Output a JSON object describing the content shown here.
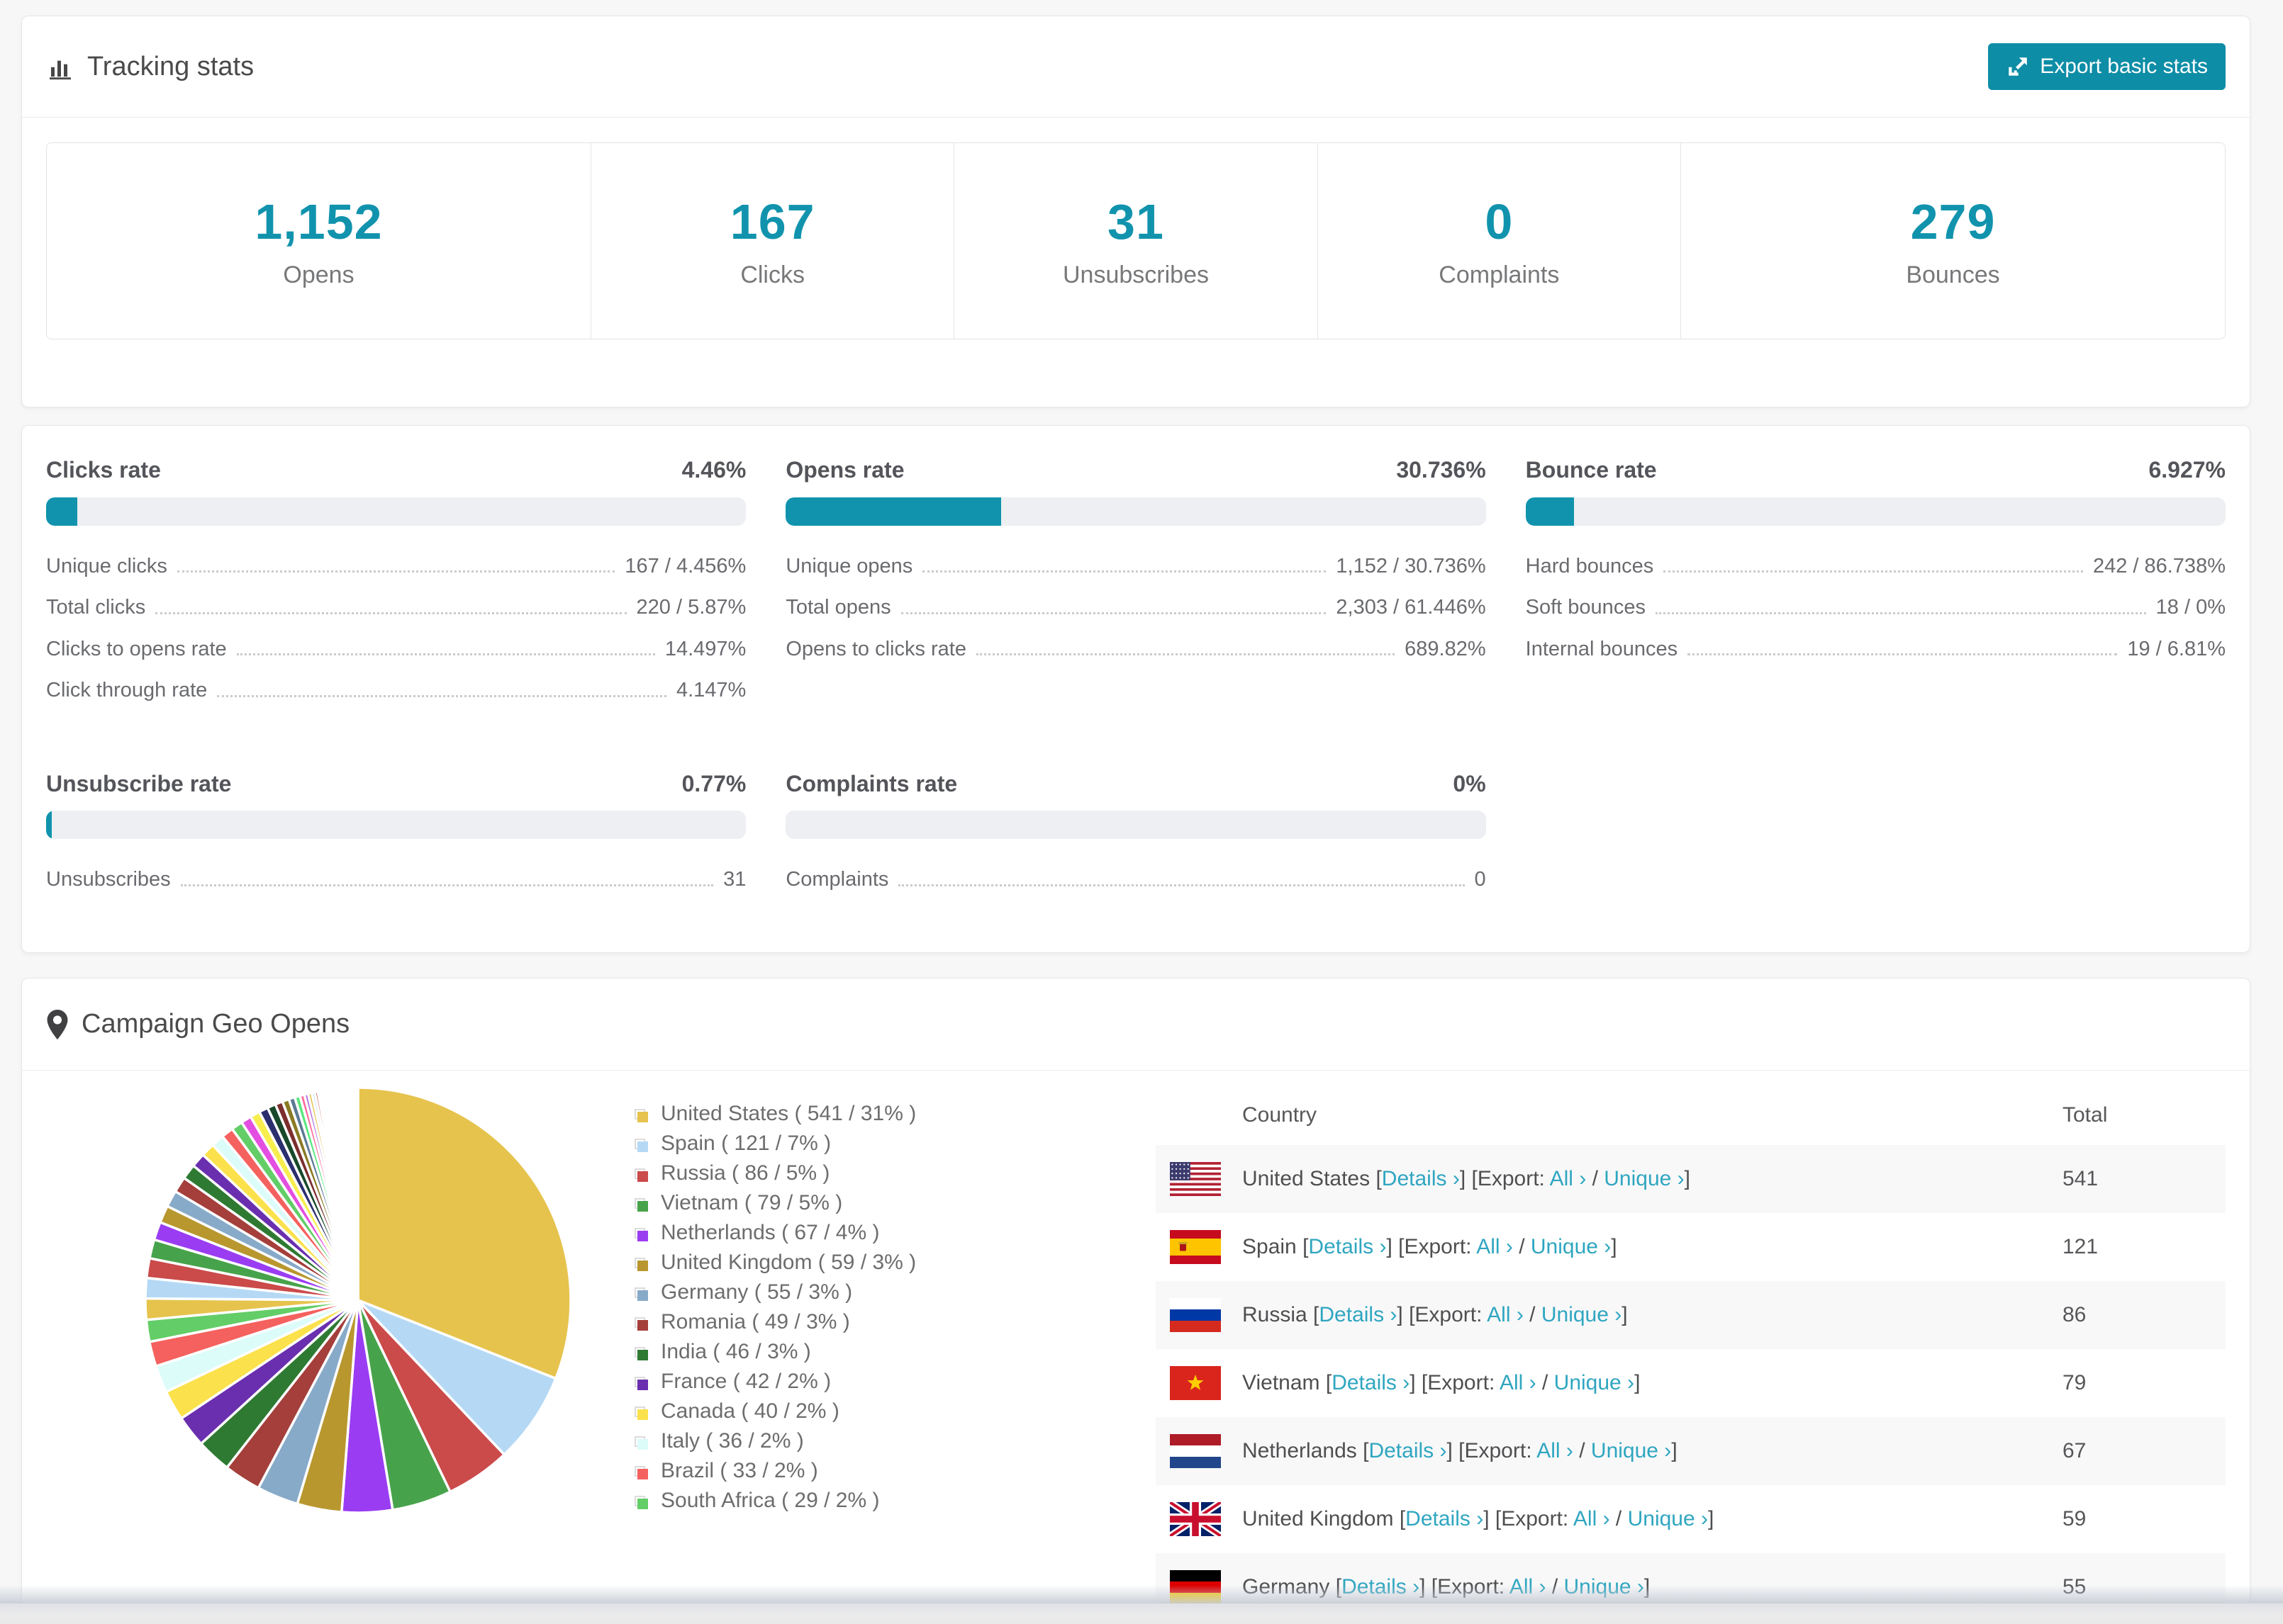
{
  "colors": {
    "accent": "#1193ad",
    "link": "#2fa6c0",
    "button": "#0d8da6",
    "track": "#edeff2"
  },
  "tracking": {
    "title": "Tracking stats",
    "export_label": "Export basic stats",
    "stats": [
      {
        "value": "1,152",
        "label": "Opens"
      },
      {
        "value": "167",
        "label": "Clicks"
      },
      {
        "value": "31",
        "label": "Unsubscribes"
      },
      {
        "value": "0",
        "label": "Complaints"
      },
      {
        "value": "279",
        "label": "Bounces"
      }
    ]
  },
  "rates": {
    "sections": [
      {
        "title": "Clicks rate",
        "value": "4.46%",
        "percent": 4.46,
        "rows": [
          {
            "label": "Unique clicks",
            "value": "167 / 4.456%"
          },
          {
            "label": "Total clicks",
            "value": "220 / 5.87%"
          },
          {
            "label": "Clicks to opens rate",
            "value": "14.497%"
          },
          {
            "label": "Click through rate",
            "value": "4.147%"
          }
        ]
      },
      {
        "title": "Opens rate",
        "value": "30.736%",
        "percent": 30.736,
        "rows": [
          {
            "label": "Unique opens",
            "value": "1,152 / 30.736%"
          },
          {
            "label": "Total opens",
            "value": "2,303 / 61.446%"
          },
          {
            "label": "Opens to clicks rate",
            "value": "689.82%"
          }
        ]
      },
      {
        "title": "Bounce rate",
        "value": "6.927%",
        "percent": 6.927,
        "rows": [
          {
            "label": "Hard bounces",
            "value": "242 / 86.738%"
          },
          {
            "label": "Soft bounces",
            "value": "18 / 0%"
          },
          {
            "label": "Internal bounces",
            "value": "19 / 6.81%"
          }
        ]
      },
      {
        "title": "Unsubscribe rate",
        "value": "0.77%",
        "percent": 0.77,
        "rows": [
          {
            "label": "Unsubscribes",
            "value": "31"
          }
        ]
      },
      {
        "title": "Complaints rate",
        "value": "0%",
        "percent": 0,
        "rows": [
          {
            "label": "Complaints",
            "value": "0"
          }
        ]
      }
    ]
  },
  "geo": {
    "title": "Campaign Geo Opens",
    "table": {
      "headers": {
        "country": "Country",
        "total": "Total"
      },
      "links": {
        "details": "Details ›",
        "export": "Export:",
        "all": "All ›",
        "unique": "Unique ›"
      },
      "rows": [
        {
          "flag": "us",
          "country": "United States",
          "total": "541"
        },
        {
          "flag": "es",
          "country": "Spain",
          "total": "121"
        },
        {
          "flag": "ru",
          "country": "Russia",
          "total": "86"
        },
        {
          "flag": "vn",
          "country": "Vietnam",
          "total": "79"
        },
        {
          "flag": "nl",
          "country": "Netherlands",
          "total": "67"
        },
        {
          "flag": "gb",
          "country": "United Kingdom",
          "total": "59"
        },
        {
          "flag": "de",
          "country": "Germany",
          "total": "55"
        }
      ]
    }
  },
  "chart_data": {
    "type": "pie",
    "title": "Campaign Geo Opens",
    "unit": "opens",
    "legend_position": "right",
    "start_angle_deg": -90,
    "direction": "clockwise",
    "slices": [
      {
        "label": "United States",
        "value": 541,
        "pct": 31,
        "color": "#e6c34d"
      },
      {
        "label": "Spain",
        "value": 121,
        "pct": 7,
        "color": "#b5d9f5"
      },
      {
        "label": "Russia",
        "value": 86,
        "pct": 5,
        "color": "#cb4a4a"
      },
      {
        "label": "Vietnam",
        "value": 79,
        "pct": 5,
        "color": "#47a34b"
      },
      {
        "label": "Netherlands",
        "value": 67,
        "pct": 4,
        "color": "#9a3df2"
      },
      {
        "label": "United Kingdom",
        "value": 59,
        "pct": 3,
        "color": "#b9972f"
      },
      {
        "label": "Germany",
        "value": 55,
        "pct": 3,
        "color": "#88aac9"
      },
      {
        "label": "Romania",
        "value": 49,
        "pct": 3,
        "color": "#a43f3b"
      },
      {
        "label": "India",
        "value": 46,
        "pct": 3,
        "color": "#2f7a33"
      },
      {
        "label": "France",
        "value": 42,
        "pct": 2,
        "color": "#6a2fae"
      },
      {
        "label": "Canada",
        "value": 40,
        "pct": 2,
        "color": "#fbe14b"
      },
      {
        "label": "Italy",
        "value": 36,
        "pct": 2,
        "color": "#dcfcfa"
      },
      {
        "label": "Brazil",
        "value": 33,
        "pct": 2,
        "color": "#f4615f"
      },
      {
        "label": "South Africa",
        "value": 29,
        "pct": 2,
        "color": "#63cd67"
      }
    ],
    "others_values": [
      28,
      27,
      26,
      25,
      24,
      23,
      22,
      21,
      20,
      19,
      18,
      17,
      16,
      15,
      14,
      13,
      12,
      11,
      10,
      9,
      8,
      7,
      6,
      5,
      5,
      4,
      4,
      3,
      3,
      3,
      2,
      2,
      2,
      2,
      2,
      2,
      2,
      2,
      2,
      2,
      1,
      1,
      1,
      1,
      1,
      1,
      1,
      1,
      1,
      1,
      1,
      1,
      1,
      1,
      1,
      1,
      1,
      1,
      1,
      1,
      1,
      1,
      1,
      1
    ],
    "palette": [
      "#e6c34d",
      "#b5d9f5",
      "#cb4a4a",
      "#47a34b",
      "#9a3df2",
      "#b9972f",
      "#88aac9",
      "#a43f3b",
      "#2f7a33",
      "#6a2fae",
      "#fbe14b",
      "#dcfcfa",
      "#f4615f",
      "#63cd67",
      "#e34fe0",
      "#f7ee4e",
      "#2b2f6e",
      "#17492a",
      "#7c2e2e",
      "#8a7a24",
      "#5d7a94",
      "#58e87c",
      "#ff6b9d",
      "#b06be0"
    ]
  }
}
